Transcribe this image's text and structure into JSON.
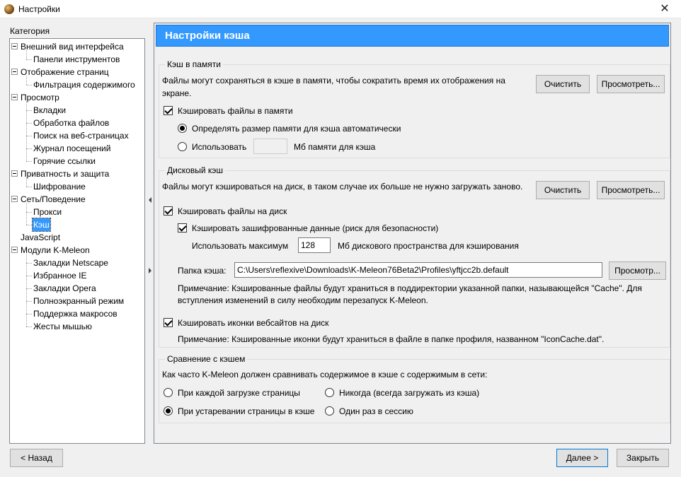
{
  "window": {
    "title": "Настройки",
    "close_glyph": "✕"
  },
  "sidebar": {
    "label": "Категория",
    "items": [
      {
        "label": "Внешний вид интерфейса",
        "level": 0,
        "expander": true
      },
      {
        "label": "Панели инструментов",
        "level": 1
      },
      {
        "label": "Отображение страниц",
        "level": 0,
        "expander": true
      },
      {
        "label": "Фильтрация содержимого",
        "level": 1
      },
      {
        "label": "Просмотр",
        "level": 0,
        "expander": true
      },
      {
        "label": "Вкладки",
        "level": 1
      },
      {
        "label": "Обработка файлов",
        "level": 1
      },
      {
        "label": "Поиск на веб-страницах",
        "level": 1
      },
      {
        "label": "Журнал посещений",
        "level": 1
      },
      {
        "label": "Горячие ссылки",
        "level": 1
      },
      {
        "label": "Приватность и защита",
        "level": 0,
        "expander": true
      },
      {
        "label": "Шифрование",
        "level": 1
      },
      {
        "label": "Сеть/Поведение",
        "level": 0,
        "expander": true
      },
      {
        "label": "Прокси",
        "level": 1
      },
      {
        "label": "Кэш",
        "level": 1,
        "selected": true
      },
      {
        "label": "JavaScript",
        "level": 0,
        "expander": false
      },
      {
        "label": "Модули K-Meleon",
        "level": 0,
        "expander": true
      },
      {
        "label": "Закладки Netscape",
        "level": 1
      },
      {
        "label": "Избранное IE",
        "level": 1
      },
      {
        "label": "Закладки Opera",
        "level": 1
      },
      {
        "label": "Полноэкранный режим",
        "level": 1
      },
      {
        "label": "Поддержка макросов",
        "level": 1
      },
      {
        "label": "Жесты мышью",
        "level": 1
      }
    ]
  },
  "panel": {
    "title": "Настройки кэша"
  },
  "memory_cache": {
    "title": "Кэш в памяти",
    "desc_line1": "Файлы могут сохраняться в кэше в памяти, чтобы сократить время их отображения на",
    "desc_line2": "экране.",
    "clear_label": "Очистить",
    "view_label": "Просмотреть...",
    "cache_in_memory_label": "Кэшировать файлы в памяти",
    "cache_in_memory_checked": true,
    "auto_size_label": "Определять размер памяти для кэша автоматически",
    "auto_size_selected": true,
    "use_label": "Использовать",
    "use_value": "",
    "mb_label": "Мб памяти для кэша"
  },
  "disk_cache": {
    "title": "Дисковый кэш",
    "desc": "Файлы могут кэшироваться на диск, в таком случае их больше не нужно загружать заново.",
    "clear_label": "Очистить",
    "view_label": "Просмотреть...",
    "cache_on_disk_label": "Кэшировать файлы на диск",
    "cache_on_disk_checked": true,
    "cache_encrypted_label": "Кэшировать зашифрованные данные (риск для безопасности)",
    "cache_encrypted_checked": true,
    "max_label": "Использовать максимум",
    "max_value": "128",
    "max_suffix": "Мб дискового пространства для кэширования",
    "folder_label": "Папка кэша:",
    "folder_value": "C:\\Users\\reflexive\\Downloads\\K-Meleon76Beta2\\Profiles\\yftjcc2b.default",
    "browse_label": "Просмотр...",
    "note1_line1": "Примечание: Кэшированные файлы будут храниться в поддиректории указанной папки, называющейся \"Cache\". Для",
    "note1_line2": "вступления изменений в силу необходим перезапуск K-Meleon.",
    "cache_icons_label": "Кэшировать иконки вебсайтов на диск",
    "cache_icons_checked": true,
    "note2": "Примечание: Кэшированные иконки будут храниться в файле в папке профиля, названном \"IconCache.dat\"."
  },
  "compare": {
    "title": "Сравнение с кэшем",
    "question": "Как часто K-Meleon должен сравнивать содержимое в кэше с содержимым в сети:",
    "every_load": "При каждой загрузке страницы",
    "never": "Никогда (всегда загружать из кэша)",
    "when_stale": "При устаревании страницы в кэше",
    "once_per_session": "Один раз в сессию",
    "selected": "when_stale"
  },
  "footer": {
    "back_label": "< Назад",
    "next_label": "Далее >",
    "close_label": "Закрыть"
  }
}
